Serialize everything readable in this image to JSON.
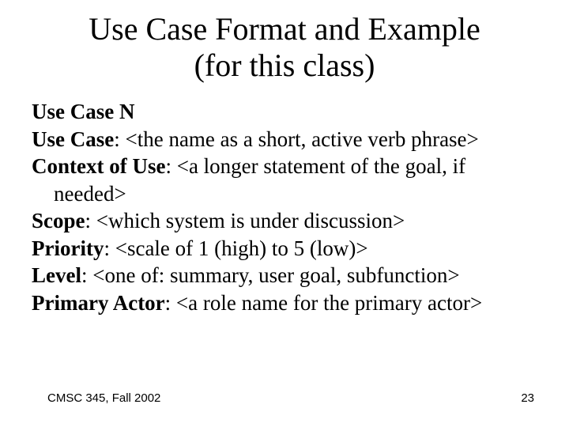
{
  "title_line1": "Use Case Format and Example",
  "title_line2": "(for this class)",
  "entries": [
    {
      "label": "Use Case N",
      "value": ""
    },
    {
      "label": "Use Case",
      "value": ": <the name as a short, active verb phrase>"
    },
    {
      "label": "Context of Use",
      "value": ": <a longer statement of the goal, if needed>"
    },
    {
      "label": "Scope",
      "value": ": <which system is under discussion>"
    },
    {
      "label": "Priority",
      "value": ": <scale of 1 (high) to 5 (low)>"
    },
    {
      "label": "Level",
      "value": ": <one of:  summary, user goal, subfunction>"
    },
    {
      "label": "Primary Actor",
      "value": ": <a role name for the primary actor>"
    }
  ],
  "footer_left": "CMSC 345, Fall 2002",
  "footer_right": "23"
}
